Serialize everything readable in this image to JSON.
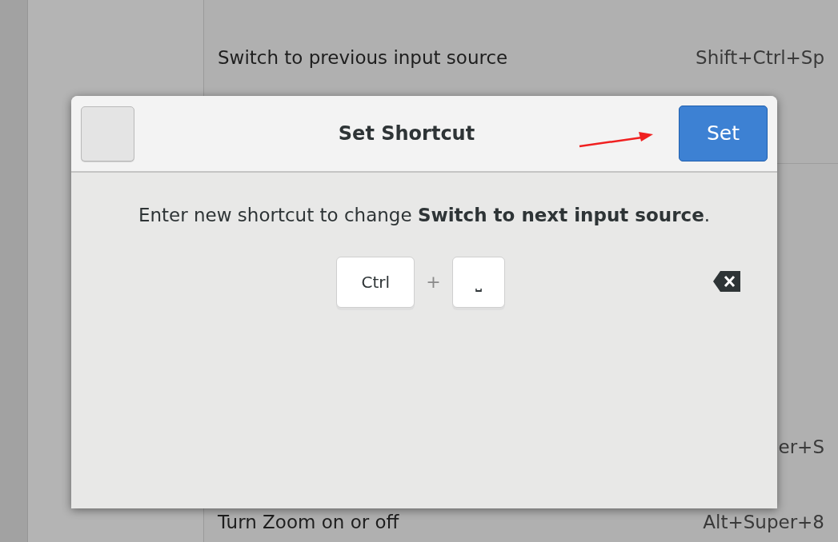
{
  "background": {
    "rows": [
      {
        "label": "Switch to previous input source",
        "shortcut": "Shift+Ctrl+Sp"
      },
      {
        "shortcut": "er+S"
      },
      {
        "label": "Turn Zoom on or off",
        "shortcut": "Alt+Super+8"
      }
    ]
  },
  "dialog": {
    "title": "Set Shortcut",
    "confirm_button": "Set",
    "message": "Enter new shortcut to change **Switch to next input source**.",
    "keys": [
      "Ctrl",
      "⎵"
    ],
    "separator": "+"
  }
}
